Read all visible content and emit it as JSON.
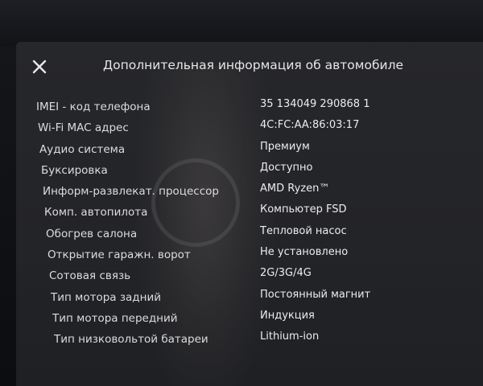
{
  "dialog": {
    "title": "Дополнительная информация об автомобиле",
    "close_icon": "close-icon"
  },
  "rows": [
    {
      "label": "IMEI - код телефона",
      "value": "35 134049 290868 1"
    },
    {
      "label": "Wi-Fi MAC адрес",
      "value": "4C:FC:AA:86:03:17"
    },
    {
      "label": "Аудио система",
      "value": "Премиум"
    },
    {
      "label": "Буксировка",
      "value": "Доступно"
    },
    {
      "label": "Информ-развлекат. процессор",
      "value": "AMD Ryzen™"
    },
    {
      "label": "Комп. автопилота",
      "value": "Компьютер FSD"
    },
    {
      "label": "Обогрев салона",
      "value": "Тепловой насос"
    },
    {
      "label": "Открытие гаражн. ворот",
      "value": "Не установлено"
    },
    {
      "label": "Сотовая связь",
      "value": "2G/3G/4G"
    },
    {
      "label": "Тип мотора задний",
      "value": "Постоянный магнит"
    },
    {
      "label": "Тип мотора передний",
      "value": "Индукция"
    },
    {
      "label": "Тип низковольтой батареи",
      "value": "Lithium-ion"
    }
  ]
}
